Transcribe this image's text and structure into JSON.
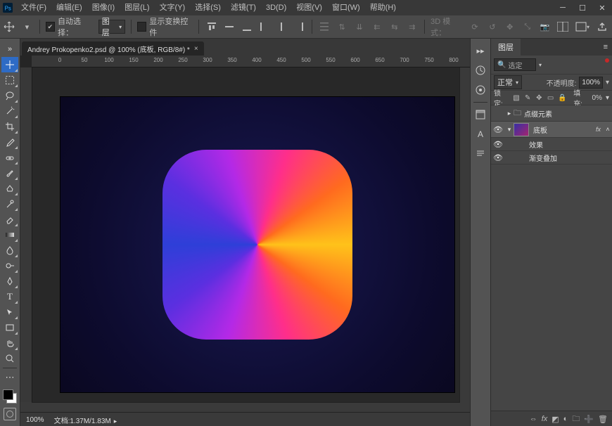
{
  "app": {
    "name": "Adobe Photoshop"
  },
  "menu": {
    "file": "文件(F)",
    "edit": "编辑(E)",
    "image": "图像(I)",
    "layer": "图层(L)",
    "type": "文字(Y)",
    "select": "选择(S)",
    "filter": "滤镜(T)",
    "threeD": "3D(D)",
    "view": "视图(V)",
    "window": "窗口(W)",
    "help": "帮助(H)"
  },
  "options": {
    "auto_select_label": "自动选择：",
    "auto_select_checked": true,
    "target_dropdown": "图层",
    "show_transform_label": "显示变换控件",
    "show_transform_checked": false,
    "mode3d_label": "3D 模式："
  },
  "document": {
    "tab_title": "Andrey Prokopenko2.psd @ 100% (底板, RGB/8#) *",
    "ruler_ticks": [
      "0",
      "50",
      "100",
      "150",
      "200",
      "250",
      "300",
      "350",
      "400",
      "450",
      "500",
      "550",
      "600",
      "650",
      "700",
      "750",
      "800"
    ]
  },
  "status": {
    "zoom": "100%",
    "doc_label": "文档:",
    "doc_size": "1.37M/1.83M"
  },
  "panels": {
    "layers": {
      "title": "图层",
      "search_placeholder": "选定",
      "blend_mode": "正常",
      "opacity_label": "不透明度:",
      "opacity_value": "100%",
      "lock_label": "锁定:",
      "fill_label": "填充:",
      "fill_value": "0%",
      "group_name": "点缀元素",
      "layer1_name": "底板",
      "effects_label": "效果",
      "effect1_label": "渐变叠加",
      "fx_badge": "fx"
    }
  },
  "colors": {
    "accent": "#2e6bc5",
    "canvas_bg": "#1a174a"
  }
}
